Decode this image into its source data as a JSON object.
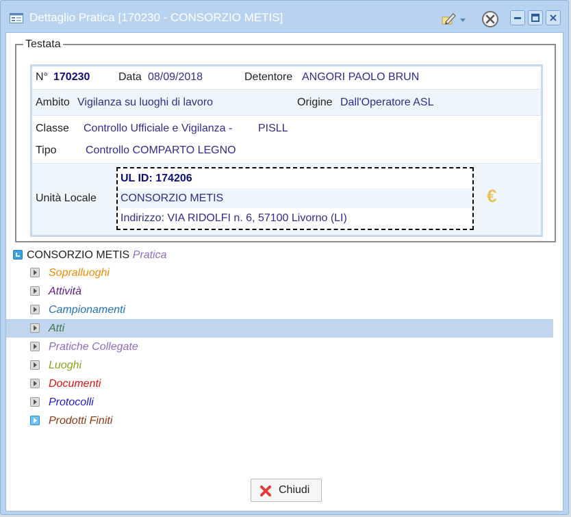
{
  "window": {
    "title": "Dettaglio Pratica [170230 - CONSORZIO METIS]",
    "colors": {
      "titlebar": "#b7d3ef",
      "border": "#99bce8",
      "link": "#2e2e8a"
    }
  },
  "testata": {
    "legend": "Testata",
    "numero_label": "N°",
    "numero": "170230",
    "data_label": "Data",
    "data": "08/09/2018",
    "detentore_label": "Detentore",
    "detentore": "ANGORI PAOLO BRUN",
    "ambito_label": "Ambito",
    "ambito": "Vigilanza su luoghi di lavoro",
    "origine_label": "Origine",
    "origine": "Dall'Operatore ASL",
    "classe_label": "Classe",
    "classe": "Controllo Ufficiale e Vigilanza -",
    "classe_suffix": "PISLL",
    "tipo_label": "Tipo",
    "tipo": "Controllo COMPARTO LEGNO",
    "ul_label": "Unità Locale",
    "ul_id": "UL ID: 174206",
    "ul_name": "CONSORZIO METIS",
    "ul_address": "Indirizzo: VIA RIDOLFI n. 6, 57100 Livorno (LI)",
    "euro_symbol": "€"
  },
  "tree": {
    "root_name": "CONSORZIO METIS",
    "root_suffix": "Pratica",
    "nodes": [
      {
        "label": "Sopralluoghi",
        "color": "#f08a00"
      },
      {
        "label": "Attività",
        "color": "#5b1a8a"
      },
      {
        "label": "Campionamenti",
        "color": "#1f6fb5"
      },
      {
        "label": "Atti",
        "color": "#3a7a4a"
      },
      {
        "label": "Pratiche Collegate",
        "color": "#8e6bc4"
      },
      {
        "label": "Luoghi",
        "color": "#8aa020"
      },
      {
        "label": "Documenti",
        "color": "#e01010"
      },
      {
        "label": "Protocolli",
        "color": "#1a1ad0"
      },
      {
        "label": "Prodotti Finiti",
        "color": "#8a3a12"
      }
    ],
    "selected_index": 3
  },
  "footer": {
    "close_label": "Chiudi"
  }
}
